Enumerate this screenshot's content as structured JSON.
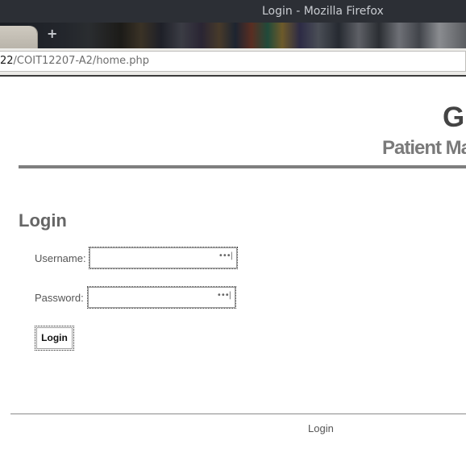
{
  "window": {
    "title": "Login - Mozilla Firefox"
  },
  "tabs": {
    "new_tab_glyph": "+"
  },
  "urlbar": {
    "host_part": "22",
    "path_part": "/COIT12207-A2/home.php"
  },
  "site": {
    "title": "G",
    "subtitle": "Patient Ma"
  },
  "login": {
    "heading": "Login",
    "username_label": "Username:",
    "password_label": "Password:",
    "username_value": "",
    "password_value": "",
    "field_indicator": "•••|",
    "submit_label": "Login"
  },
  "footer": {
    "link_label": "Login"
  },
  "colors": {
    "titlebar_bg": "#2c2f35",
    "rule_gray": "#7f7f7f",
    "heading_gray": "#666666"
  }
}
